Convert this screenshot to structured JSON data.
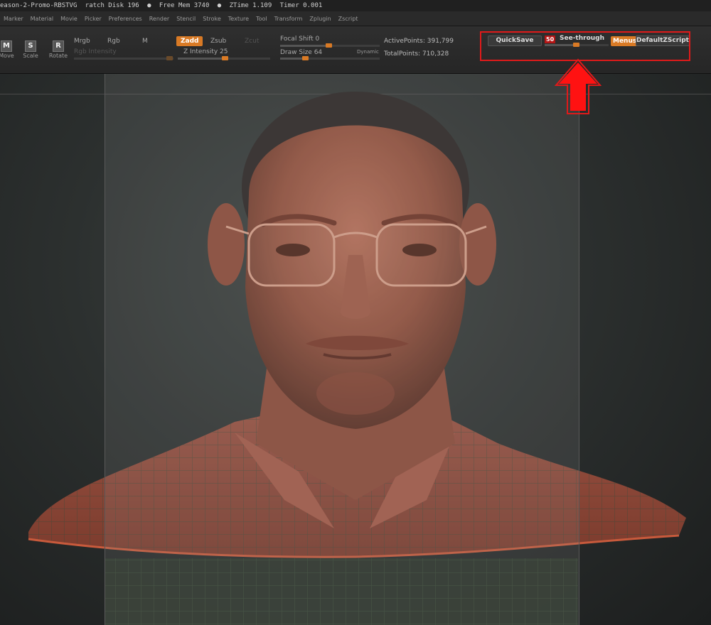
{
  "status": {
    "left": "eason-2-Promo-RBSTVG",
    "scratch_disk": "ratch Disk 196",
    "free_mem": "Free Mem 3740",
    "ztime": "ZTime 1.109",
    "timer": "Timer 0.001"
  },
  "menu": [
    "Marker",
    "Material",
    "Movie",
    "Picker",
    "Preferences",
    "Render",
    "Stencil",
    "Stroke",
    "Texture",
    "Tool",
    "Transform",
    "Zplugin",
    "Zscript"
  ],
  "tools": {
    "move": {
      "icon": "M",
      "label": "Move"
    },
    "scale": {
      "icon": "S",
      "label": "Scale"
    },
    "rotate": {
      "icon": "R",
      "label": "Rotate"
    }
  },
  "brush": {
    "mrgb": "Mrgb",
    "rgb": "Rgb",
    "m": "M",
    "rgb_intensity": "Rgb Intensity",
    "zadd": "Zadd",
    "zsub": "Zsub",
    "zcut": "Zcut",
    "z_intensity": "Z Intensity 25",
    "focal_shift": "Focal Shift 0",
    "draw_size": "Draw Size 64",
    "dynamic": "Dynamic"
  },
  "stats": {
    "active_points": "ActivePoints: 391,799",
    "total_points": "TotalPoints: 710,328"
  },
  "right_panel": {
    "quicksave": "QuickSave",
    "see_through_value": "50",
    "see_through_label": "See-through",
    "menus": "Menus",
    "default_zscript": "DefaultZScript"
  },
  "colors": {
    "accent": "#d97a25",
    "highlight": "#e01a1a",
    "skin": "#a65a45",
    "shirt_grid": "#2d3a2c"
  },
  "icons": {
    "arrow": "up-arrow-icon"
  }
}
